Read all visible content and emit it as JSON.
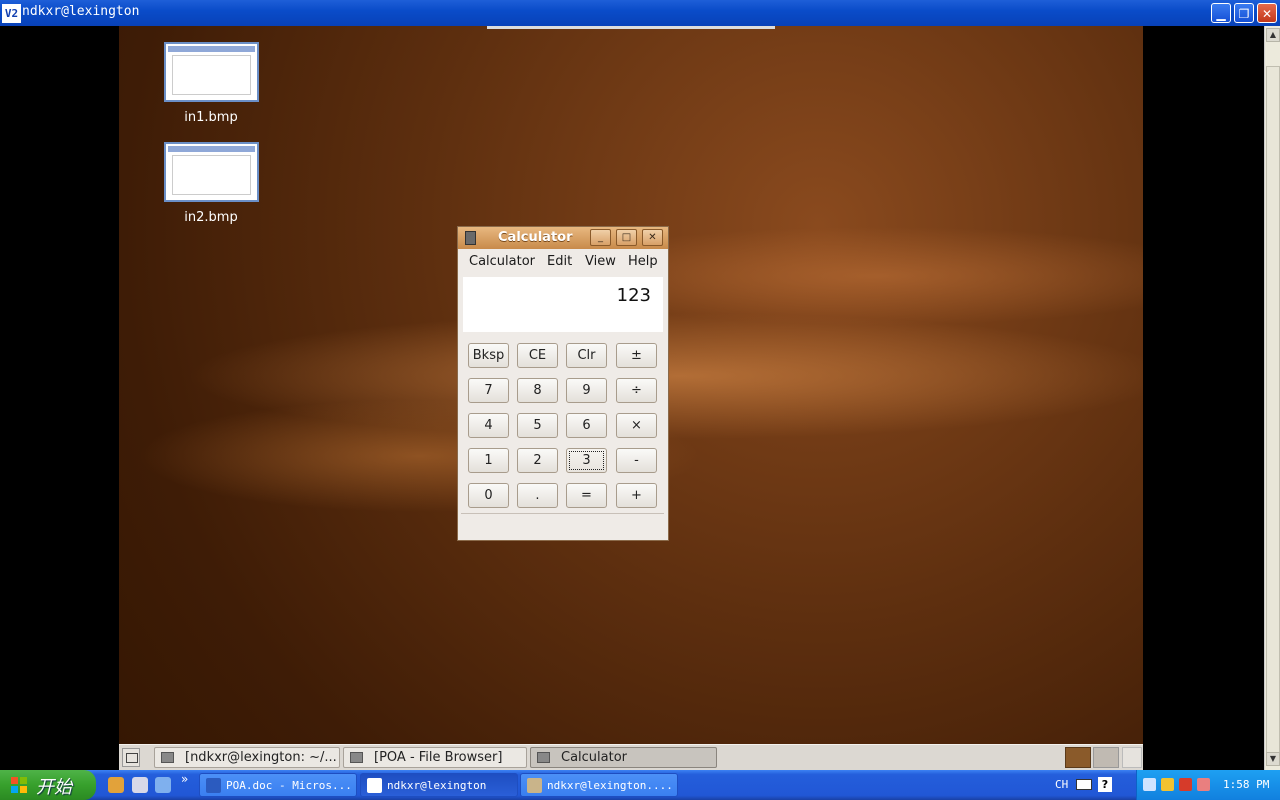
{
  "vnc_window": {
    "title": "ndkxr@lexington",
    "icon_text": "V2"
  },
  "desktop": {
    "icons": [
      {
        "label": "in1.bmp"
      },
      {
        "label": "in2.bmp"
      }
    ]
  },
  "calculator": {
    "title": "Calculator",
    "menus": [
      "Calculator",
      "Edit",
      "View",
      "Help"
    ],
    "display_value": "123",
    "keys": [
      [
        "Bksp",
        "CE",
        "Clr",
        "±"
      ],
      [
        "7",
        "8",
        "9",
        "÷"
      ],
      [
        "4",
        "5",
        "6",
        "×"
      ],
      [
        "1",
        "2",
        "3",
        "-"
      ],
      [
        "0",
        ".",
        "=",
        "+"
      ]
    ],
    "focused_key": "3"
  },
  "remote_panel": {
    "tasks": [
      {
        "label": "[ndkxr@lexington: ~/..."
      },
      {
        "label": "[POA - File Browser]"
      },
      {
        "label": "Calculator",
        "active": true
      }
    ]
  },
  "xp_taskbar": {
    "start_label": "开始",
    "quick_launch_more": "»",
    "tasks": [
      {
        "label": "POA.doc - Micros..."
      },
      {
        "label": "ndkxr@lexington",
        "active": true
      },
      {
        "label": "ndkxr@lexington...."
      }
    ],
    "language": "CH",
    "clock": "1:58 PM"
  },
  "colors": {
    "xp_blue": "#245edb",
    "start_green": "#37a02c",
    "calc_title": "#c88a4a",
    "desktop_brown": "#5e2f0f"
  }
}
